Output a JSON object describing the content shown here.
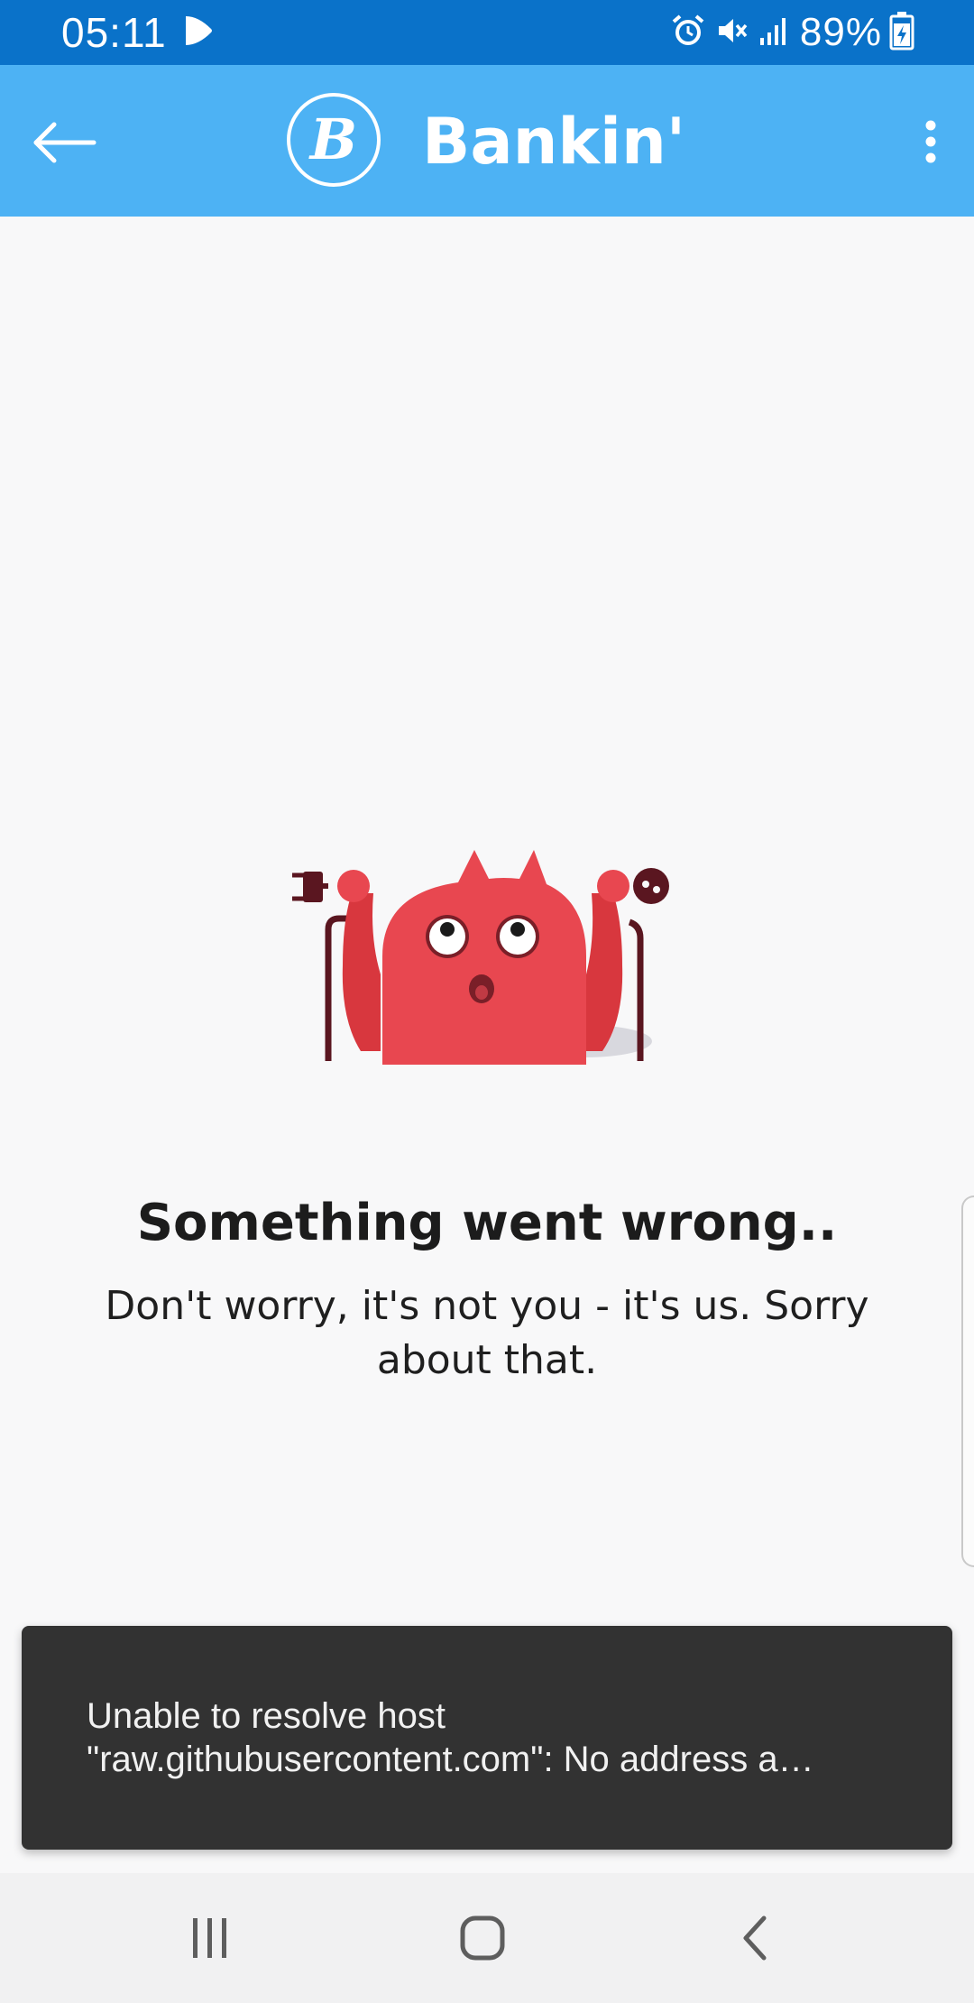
{
  "status_bar": {
    "time": "05:11",
    "battery_percent": "89%",
    "icons": [
      "play-icon",
      "alarm-icon",
      "mute-icon",
      "signal-icon",
      "battery-charging-icon"
    ],
    "background_color": "#0a72c9"
  },
  "app_bar": {
    "title": "Bankin'",
    "logo_letter": "B",
    "back_icon": "arrow-left-icon",
    "menu_icon": "more-vert-icon",
    "background_color": "#4db2f4"
  },
  "error": {
    "title": "Something went wrong..",
    "message_line1": "Don't worry, it's not you - it's us. Sorry",
    "message_line2": "about that.",
    "illustration": "unplugged-monster-illustration"
  },
  "snackbar": {
    "line1": "Unable to resolve host",
    "line2": "\"raw.githubusercontent.com\": No address a…",
    "background_color": "#323232"
  },
  "nav_bar": {
    "icons": [
      "recents-icon",
      "home-icon",
      "back-chevron-icon"
    ]
  }
}
